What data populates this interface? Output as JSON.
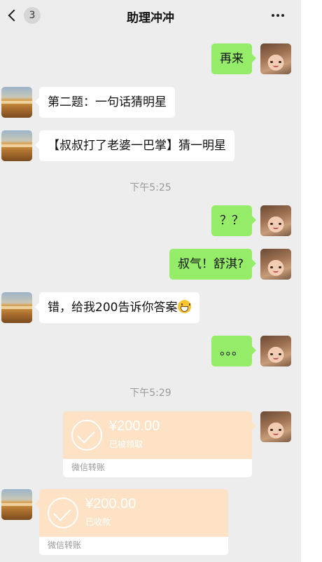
{
  "header": {
    "unread_count": "3",
    "title": "助理冲冲"
  },
  "messages": [
    {
      "side": "out",
      "text": "再来"
    },
    {
      "side": "in",
      "text": "第二题：一句话猜明星"
    },
    {
      "side": "in",
      "text": "【叔叔打了老婆一巴掌】猜一明星"
    },
    {
      "side": "out",
      "text": "？？"
    },
    {
      "side": "out",
      "text": "叔气！舒淇?"
    },
    {
      "side": "in",
      "text": "错，给我200告诉你答案"
    },
    {
      "side": "out",
      "text": "。。。"
    }
  ],
  "timestamps": [
    "下午5:25",
    "下午5:29"
  ],
  "transfers": [
    {
      "side": "out",
      "amount": "¥200.00",
      "status": "已被领取",
      "label": "微信转账"
    },
    {
      "side": "in",
      "amount": "¥200.00",
      "status": "已收款",
      "label": "微信转账"
    }
  ],
  "colors": {
    "background": "#ededed",
    "outgoing_bubble": "#95ec69",
    "incoming_bubble": "#ffffff",
    "transfer_card": "#fde2c6",
    "timestamp_text": "#9a9a9a"
  },
  "icons": {
    "back": "chevron-left-icon",
    "more": "more-dots-icon",
    "transfer": "check-circle-icon",
    "emoji": "grinning-face-emoji"
  }
}
